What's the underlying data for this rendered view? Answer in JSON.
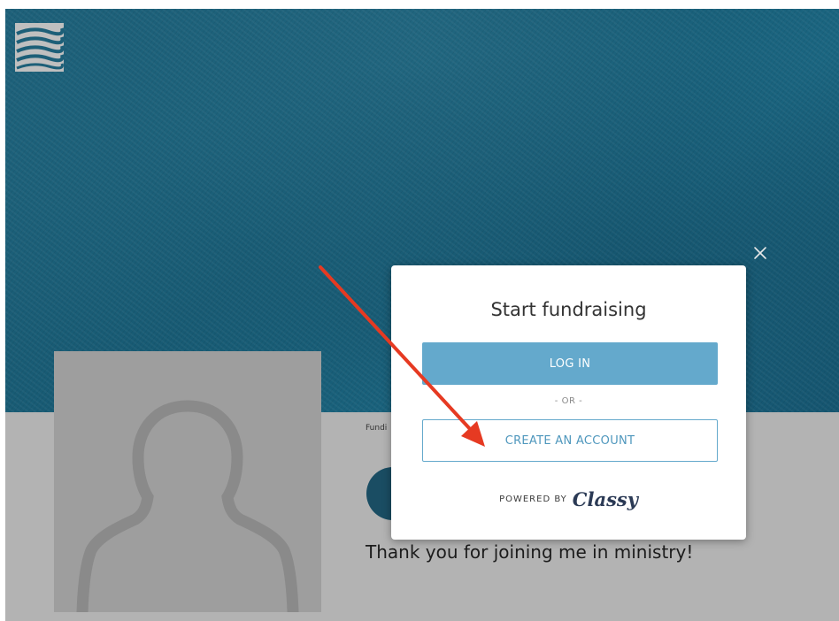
{
  "header": {
    "logo_icon": "waves-logo-icon"
  },
  "modal": {
    "title": "Start fundraising",
    "login_label": "LOG IN",
    "or_label": "- OR -",
    "create_account_label": "CREATE AN ACCOUNT",
    "powered_by_label": "POWERED BY",
    "powered_by_brand": "Classy",
    "close_icon": "close-icon"
  },
  "page": {
    "fundraiser_label": "Fundi",
    "message": "Thank you for joining me in ministry!"
  },
  "colors": {
    "hero": "#1a6079",
    "accent": "#64a9cc",
    "annotation_arrow": "#e63a22"
  }
}
